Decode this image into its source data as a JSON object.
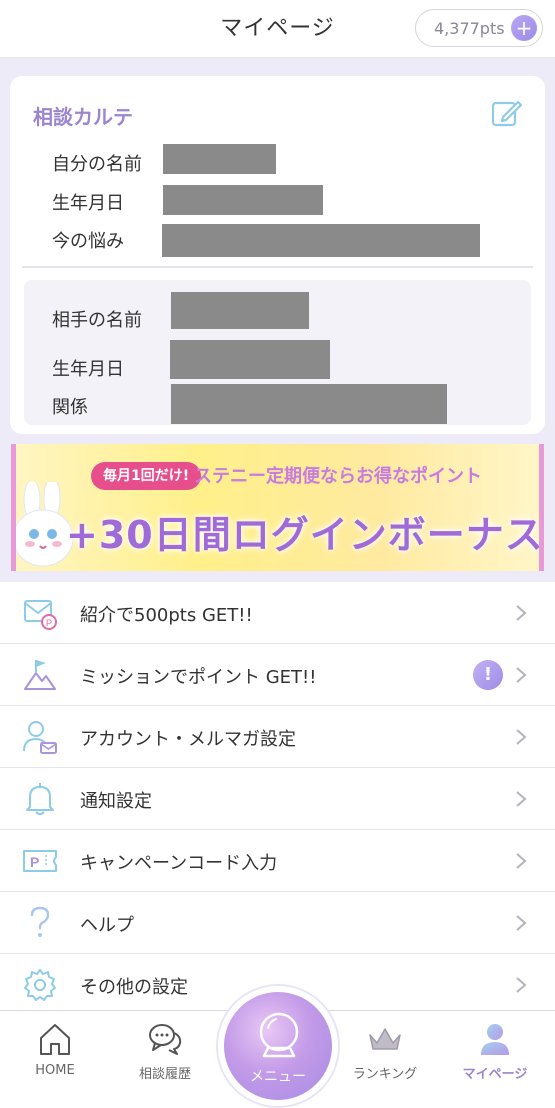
{
  "header": {
    "title": "マイページ",
    "points": "4,377pts",
    "plus": "+"
  },
  "karte": {
    "title": "相談カルテ",
    "rows": [
      {
        "label": "自分の名前"
      },
      {
        "label": "生年月日"
      },
      {
        "label": "今の悩み"
      }
    ],
    "partner_rows": [
      {
        "label": "相手の名前"
      },
      {
        "label": "生年月日"
      },
      {
        "label": "関係"
      }
    ]
  },
  "banner": {
    "tag": "毎月1回だけ!",
    "sub": "ステニー定期便ならお得なポイント",
    "main": "+30日間ログインボーナス"
  },
  "menu": [
    {
      "label": "紹介で500pts GET!!",
      "icon": "invite-mail-icon"
    },
    {
      "label": "ミッションでポイント GET!!",
      "icon": "mission-flag-icon",
      "badge": "!"
    },
    {
      "label": "アカウント・メルマガ設定",
      "icon": "account-mail-icon"
    },
    {
      "label": "通知設定",
      "icon": "bell-icon"
    },
    {
      "label": "キャンペーンコード入力",
      "icon": "campaign-code-icon"
    },
    {
      "label": "ヘルプ",
      "icon": "help-icon"
    },
    {
      "label": "その他の設定",
      "icon": "gear-icon"
    }
  ],
  "tabs": [
    {
      "label": "HOME",
      "icon": "home-icon"
    },
    {
      "label": "相談履歴",
      "icon": "chat-history-icon"
    },
    {
      "label": "メニュー",
      "icon": "crystal-ball-icon"
    },
    {
      "label": "ランキング",
      "icon": "crown-icon"
    },
    {
      "label": "マイページ",
      "icon": "user-icon",
      "active": true
    }
  ],
  "colors": {
    "accent": "#9b85d0",
    "lavender_bg": "#ecebf7",
    "redaction": "#8a8a8a"
  }
}
